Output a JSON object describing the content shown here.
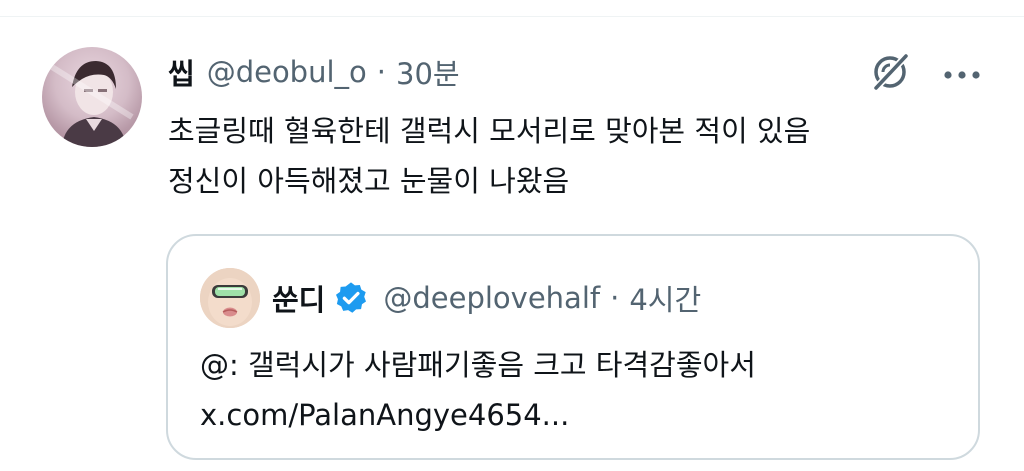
{
  "tweet": {
    "author_name": "씹",
    "handle": "@deobul_o",
    "separator": "·",
    "time": "30분",
    "lines": [
      "초글링때 혈육한테 갤럭시 모서리로 맞아본 적이 있음",
      "정신이 아득해졌고 눈물이 나왔음"
    ],
    "grok_icon": "grok-icon",
    "more_icon": "more-icon"
  },
  "quoted": {
    "author_name": "쑨디",
    "verified_icon": "verified-badge-icon",
    "verified_color": "#1d9bf0",
    "handle": "@deeplovehalf",
    "separator": "·",
    "time": "4시간",
    "lines": [
      "@: 갤럭시가 사람패기좋음 크고 타격감좋아서",
      "x.com/PalanAngye4654..."
    ]
  },
  "colors": {
    "text_primary": "#0f1419",
    "text_secondary": "#536471",
    "border": "#cfd9de"
  }
}
